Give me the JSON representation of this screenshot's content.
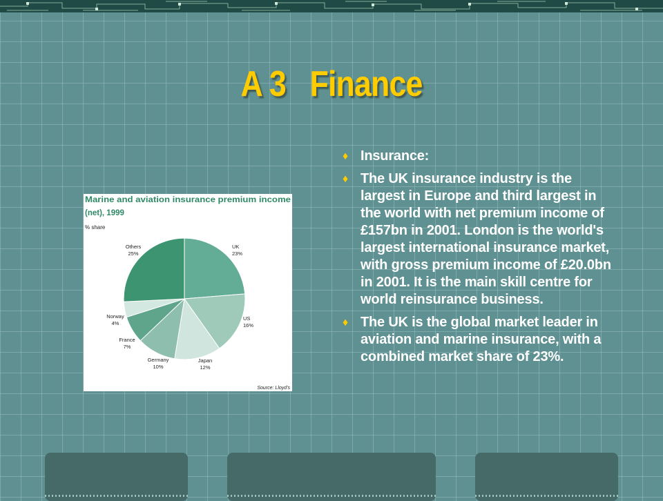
{
  "slide": {
    "title": "A 3   Finance",
    "bullets": [
      "Insurance:",
      "The UK insurance industry is the largest in Europe and third largest in the world with net premium income of £157bn in 2001. London is the world's largest international insurance market, with gross premium income of £20.0bn in 2001. It is the main skill centre for world reinsurance business.",
      "The UK is the global market leader in aviation and marine insurance, with a combined market share of 23%."
    ]
  },
  "chart_data": {
    "type": "pie",
    "title": "Marine and aviation insurance premium income (net), 1999",
    "title_line1": "Marine and aviation insurance premium income",
    "title_line2": "(net), 1999",
    "subtitle": "% share",
    "source": "Source: Lloyd's",
    "slices": [
      {
        "label": "UK",
        "value": 23,
        "value_label": "23%",
        "color": "#63ad96"
      },
      {
        "label": "US",
        "value": 16,
        "value_label": "16%",
        "color": "#9fcaba"
      },
      {
        "label": "Japan",
        "value": 12,
        "value_label": "12%",
        "color": "#cfe5dd"
      },
      {
        "label": "Germany",
        "value": 10,
        "value_label": "10%",
        "color": "#8ebfae"
      },
      {
        "label": "France",
        "value": 7,
        "value_label": "7%",
        "color": "#5ea58b"
      },
      {
        "label": "Norway",
        "value": 4,
        "value_label": "4%",
        "color": "#d3e8e1"
      },
      {
        "label": "Others",
        "value": 25,
        "value_label": "25%",
        "color": "#3d9470"
      }
    ],
    "colors": {
      "title": "#2e8a66",
      "stroke": "#1e4a3c",
      "text": "#222222"
    }
  },
  "theme": {
    "title_color": "#ffcc00",
    "text_color": "#ffffff",
    "background": "#5f9092"
  }
}
